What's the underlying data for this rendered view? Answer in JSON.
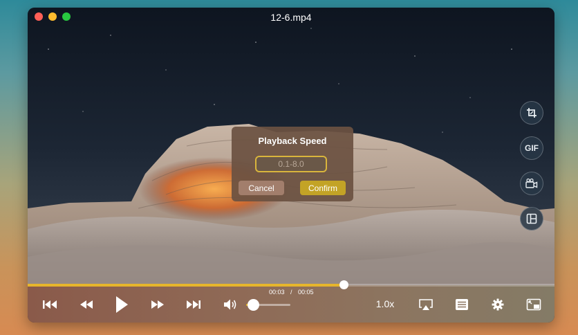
{
  "window": {
    "title": "12-6.mp4"
  },
  "side_tools": [
    {
      "name": "crop-icon",
      "label": ""
    },
    {
      "name": "gif-icon",
      "label": "GIF"
    },
    {
      "name": "video-camera-icon",
      "label": ""
    },
    {
      "name": "layout-icon",
      "label": ""
    }
  ],
  "dialog": {
    "title": "Playback Speed",
    "input_placeholder": "0.1-8.0",
    "input_value": "",
    "cancel_label": "Cancel",
    "confirm_label": "Confirm"
  },
  "playback": {
    "current_time": "00:03",
    "separator": "/",
    "duration": "00:05",
    "progress_fraction": 0.6,
    "volume_fraction": 0.15,
    "speed": "1.0x"
  },
  "colors": {
    "accent": "#e6b52c",
    "confirm": "#c3a326",
    "dialog_bg": "#6c5242"
  }
}
